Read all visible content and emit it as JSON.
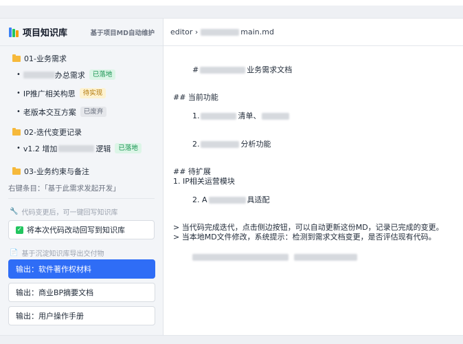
{
  "sidebar": {
    "title": "项目知识库",
    "subtitle": "基于项目MD自动维护",
    "folders": [
      {
        "name": "01-业务需求",
        "items": [
          {
            "label": "办总需求",
            "badge": "已落地"
          },
          {
            "label": "IP推广相关构思",
            "badge": "待实现"
          },
          {
            "label": "老版本交互方案",
            "badge": "已废弃"
          }
        ]
      },
      {
        "name": "02-迭代变更记录",
        "items": [
          {
            "prefix": "v1.2 增加",
            "suffix": "逻辑",
            "badge": "已落地"
          }
        ]
      },
      {
        "name": "03-业务约束与备注",
        "items": []
      }
    ],
    "context_hint": "右键条目：「基于此需求发起开发」",
    "writeback_section": "代码变更后，可一键回写知识库",
    "writeback_checkbox": "将本次代码改动回写到知识库",
    "export_section": "基于沉淀知识库导出交付物",
    "export_buttons": [
      "输出：软件著作权材料",
      "输出：商业BP摘要文档",
      "输出：用户操作手册"
    ]
  },
  "editor": {
    "path_prefix": "editor ›",
    "path_suffix": "main.md",
    "lines": {
      "l1_prefix": "#",
      "l1_suffix": "业务需求文档",
      "l3": "## 当前功能",
      "l4_prefix": "1.",
      "l4_mid": "清单、",
      "l5_prefix": "2.",
      "l5_suffix": "分析功能",
      "l7": "## 待扩展",
      "l8": "1. IP相关运营模块",
      "l9_prefix": "2. A",
      "l9_suffix": "具适配",
      "l11": "> 当代码完成迭代，点击侧边按钮，可以自动更新这份MD，记录已完成的变更。",
      "l12": "> 当本地MD文件修改，系统提示：检测到需求文档变更，是否评估现有代码。"
    }
  },
  "icons": {
    "logo": "books-icon",
    "folder": "folder-icon",
    "wrench": "wrench-icon",
    "document": "document-icon",
    "check": "checkbox-checked-icon"
  },
  "colors": {
    "primary": "#2f6df6",
    "success_bg": "#dcf5e7",
    "success_fg": "#15924f",
    "pending_bg": "#fdf2d0",
    "pending_fg": "#b07505",
    "deprecated_bg": "#e5e7eb",
    "deprecated_fg": "#6b7280",
    "folder": "#f6b93b"
  }
}
